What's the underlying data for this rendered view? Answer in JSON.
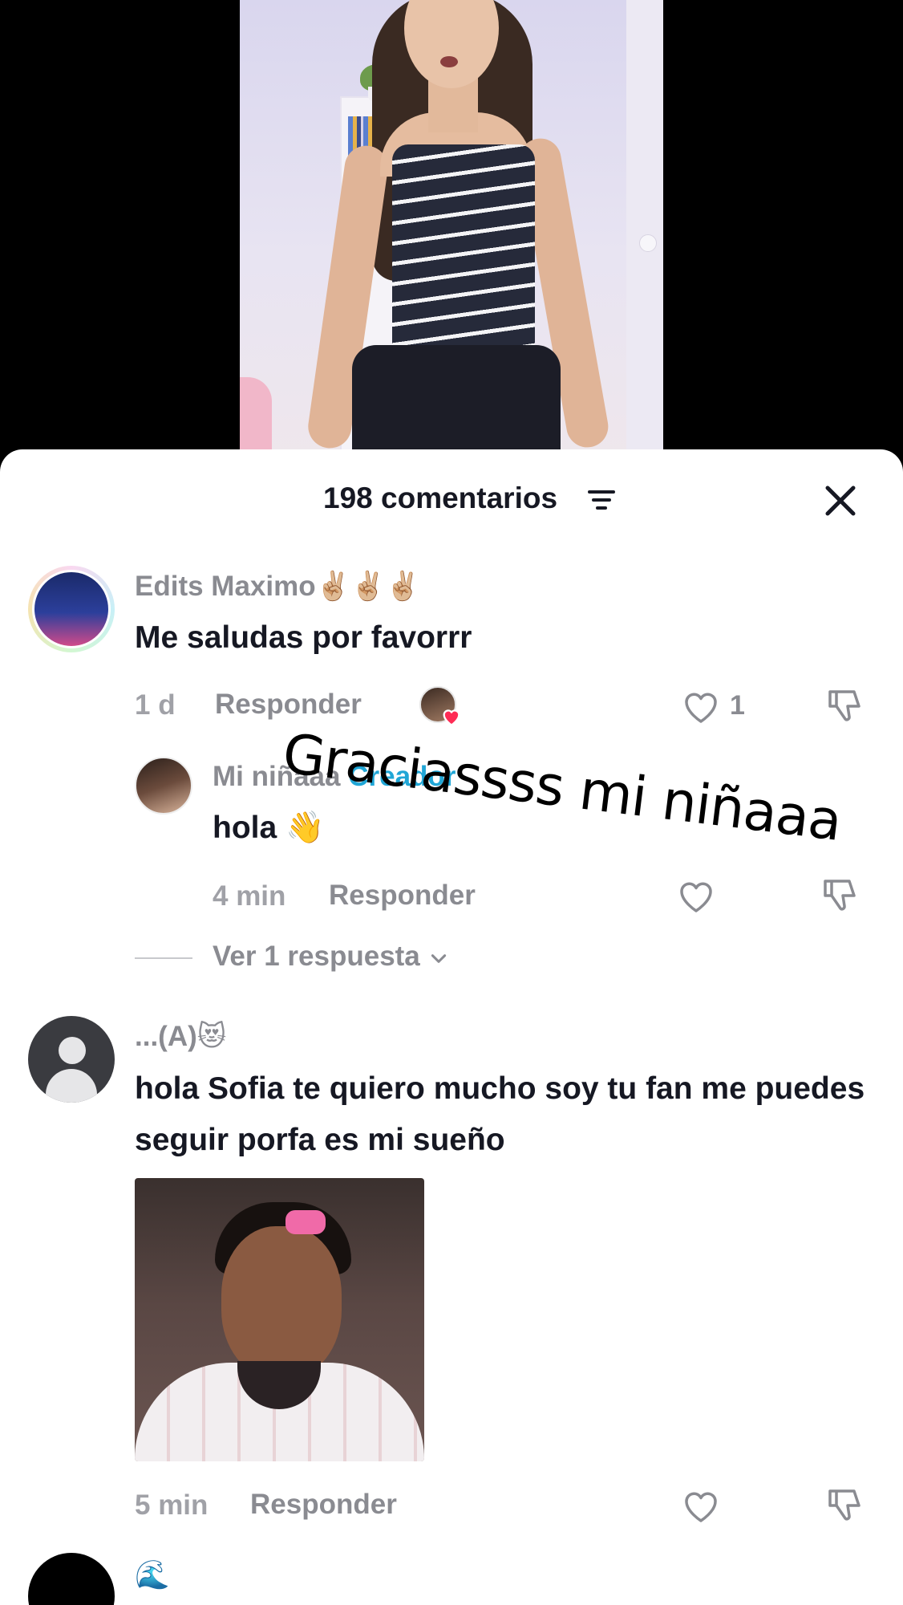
{
  "header": {
    "comment_count": "198 comentarios"
  },
  "icons": {
    "sort": "sort-lines-icon",
    "close": "close-x-icon",
    "like": "heart-outline-icon",
    "dislike": "thumb-down-icon"
  },
  "colors": {
    "sheet_bg": "#ffffff",
    "primary_text": "#161823",
    "secondary_text": "#8a8b91",
    "creator_tag": "#20a6d6",
    "liked_by_creator_heart": "#fe2c55"
  },
  "comments": [
    {
      "username": "Edits Maximo✌🏼✌🏼✌🏼",
      "text": "Me saludas por favorrr",
      "time": "1 d",
      "reply_label": "Responder",
      "like_count": "1",
      "liked_by_creator": true
    }
  ],
  "reply": {
    "username": "Mi niñaaa",
    "creator_label": "Creador",
    "text": "hola 👋",
    "time": "4 min",
    "reply_label": "Responder"
  },
  "view_replies": "Ver 1 respuesta",
  "comment2": {
    "username": "...(A)😻",
    "text": "hola Sofia te quiero mucho soy tu fan me puedes seguir porfa es mi sueño",
    "time": "5 min",
    "reply_label": "Responder"
  },
  "comment3": {
    "username": "🌊"
  },
  "overlay_text": "Graciassss mi niñaaa"
}
